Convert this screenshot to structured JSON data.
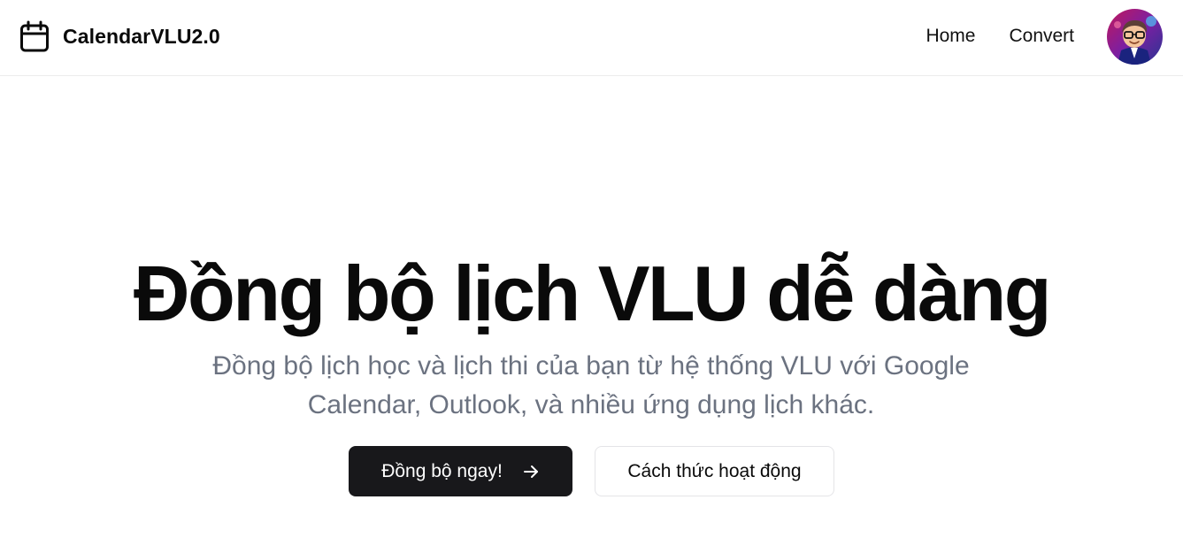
{
  "header": {
    "brand_name": "CalendarVLU2.0",
    "brand_icon": "calendar-icon",
    "nav": [
      {
        "label": "Home"
      },
      {
        "label": "Convert"
      }
    ],
    "avatar_icon": "user-avatar"
  },
  "hero": {
    "title": "Đồng bộ lịch VLU dễ dàng",
    "subtitle": "Đồng bộ lịch học và lịch thi của bạn từ hệ thống VLU với Google Calendar, Outlook, và nhiều ứng dụng lịch khác.",
    "primary_button": {
      "label": "Đồng bộ ngay!",
      "icon": "arrow-right-icon"
    },
    "secondary_button": {
      "label": "Cách thức hoạt động"
    }
  },
  "colors": {
    "primary_button_bg": "#18181b",
    "subtitle_text": "#6b7280",
    "border": "#e4e4e7"
  }
}
